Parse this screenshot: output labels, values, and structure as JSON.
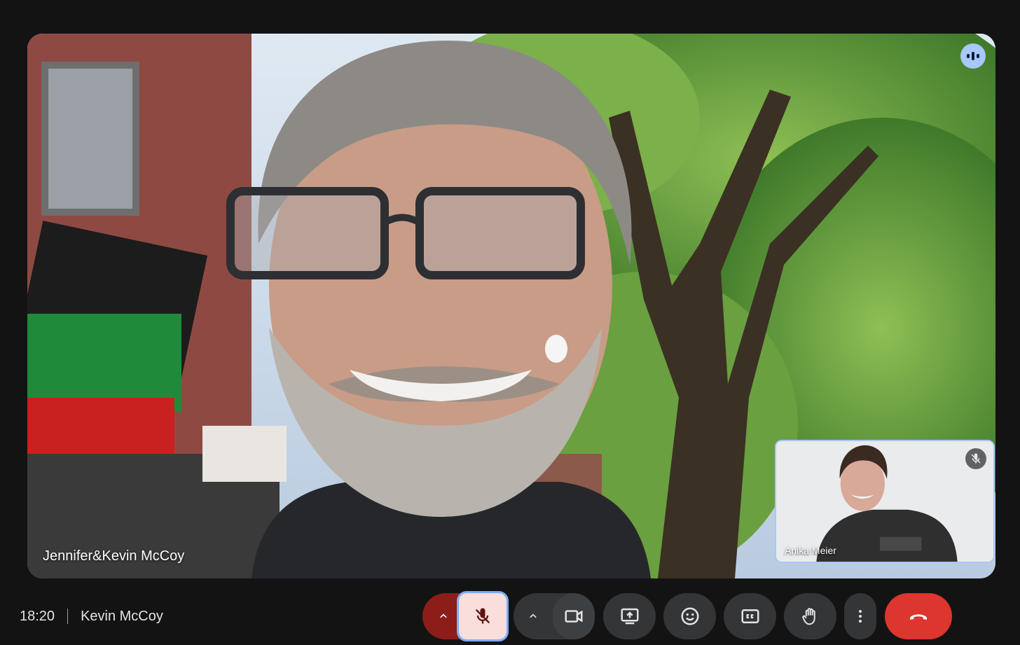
{
  "meeting": {
    "time": "18:20",
    "user_name": "Kevin McCoy"
  },
  "main_video": {
    "participant_name": "Jennifer&Kevin McCoy",
    "speaking": true
  },
  "self_view": {
    "participant_name": "Anika Meier",
    "muted": true
  },
  "controls": {
    "mic_options": "chevron-up-icon",
    "mic": "mic-off-icon",
    "camera_options": "chevron-up-icon",
    "camera": "videocam-icon",
    "present": "present-screen-icon",
    "reactions": "emoji-icon",
    "captions": "closed-captions-icon",
    "raise_hand": "hand-icon",
    "more": "more-vertical-icon",
    "leave": "call-end-icon"
  },
  "colors": {
    "background": "#131314",
    "control": "#333537",
    "mic_off_bg": "#f9dedc",
    "mic_options_bg": "#8c1d18",
    "leave": "#dc362e",
    "accent": "#a8c7fa"
  }
}
